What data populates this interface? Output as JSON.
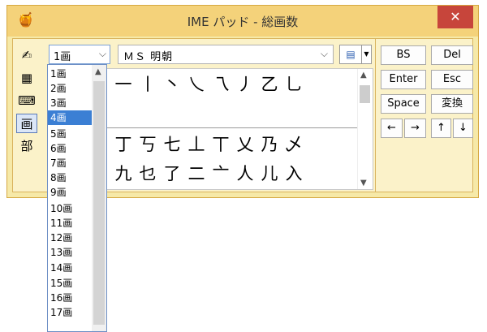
{
  "window": {
    "title": "IME パッド - 総画数",
    "close_label": "✕",
    "app_icon": "🍯"
  },
  "toolbar": {
    "strokes_value": "1画",
    "font_value": "ＭＳ 明朝",
    "view_icon": "view-toggle-icon"
  },
  "left_tools": [
    {
      "name": "handwriting-icon",
      "glyph": "✍"
    },
    {
      "name": "character-list-icon",
      "glyph": "▦"
    },
    {
      "name": "soft-keyboard-icon",
      "glyph": "⌨"
    },
    {
      "name": "total-strokes-icon",
      "glyph": "画",
      "active": true
    },
    {
      "name": "radical-icon",
      "glyph": "部"
    }
  ],
  "grid": {
    "row1": [
      "一",
      "丨",
      "丶",
      "乀",
      "乁",
      "丿",
      "乙",
      "乚"
    ],
    "row2": [
      "丁",
      "丂",
      "七",
      "丄",
      "丅",
      "乂",
      "乃",
      "乄"
    ],
    "row3": [
      "九",
      "乜",
      "了",
      "二",
      "亠",
      "人",
      "儿",
      "入"
    ]
  },
  "keys": {
    "bs": "BS",
    "del": "Del",
    "enter": "Enter",
    "esc": "Esc",
    "space": "Space",
    "convert": "変換",
    "left": "←",
    "right": "→",
    "up": "↑",
    "down": "↓"
  },
  "dropdown": {
    "items": [
      "1画",
      "2画",
      "3画",
      "4画",
      "5画",
      "6画",
      "7画",
      "8画",
      "9画",
      "10画",
      "11画",
      "12画",
      "13画",
      "14画",
      "15画",
      "16画",
      "17画"
    ],
    "selected_index": 3
  },
  "colors": {
    "title_bar": "#f4d27a",
    "close": "#c7453b",
    "selection": "#3b7fd4"
  }
}
